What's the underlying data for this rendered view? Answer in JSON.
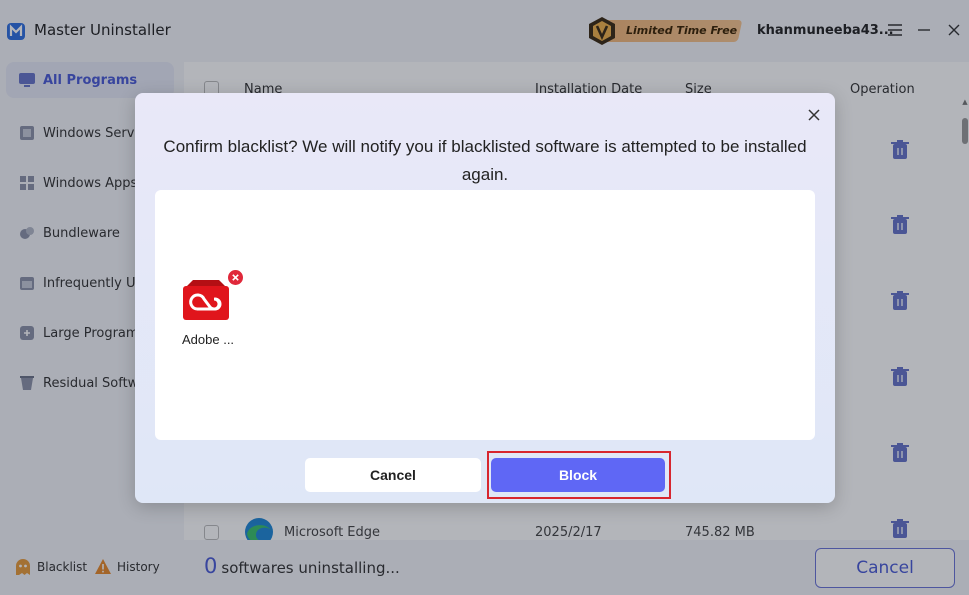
{
  "app": {
    "title": "Master Uninstaller"
  },
  "header": {
    "promo_text": "Limited Time Free",
    "username": "khanmuneeba43..."
  },
  "sidebar": {
    "items": [
      {
        "label": "All Programs",
        "icon": "monitor-icon",
        "active": true
      },
      {
        "label": "Windows Servi",
        "icon": "windows-service-icon"
      },
      {
        "label": "Windows Apps",
        "icon": "windows-apps-icon"
      },
      {
        "label": "Bundleware",
        "icon": "bundle-icon"
      },
      {
        "label": "Infrequently Us",
        "icon": "calendar-icon"
      },
      {
        "label": "Large Program",
        "icon": "large-program-icon"
      },
      {
        "label": "Residual Softw",
        "icon": "residual-icon"
      }
    ]
  },
  "table": {
    "headers": {
      "name": "Name",
      "install_date": "Installation Date",
      "size": "Size",
      "operation": "Operation"
    },
    "visible_row": {
      "name": "Microsoft Edge",
      "install_date": "2025/2/17",
      "size": "745.82 MB"
    }
  },
  "footer": {
    "blacklist_label": "Blacklist",
    "history_label": "History",
    "uninstalling_count": "0",
    "uninstalling_text": "softwares uninstalling...",
    "cancel_label": "Cancel"
  },
  "dialog": {
    "title": "Confirm blacklist? We will notify you if blacklisted software is attempted to be installed again.",
    "apps": [
      {
        "name": "Adobe ...",
        "icon": "adobe-creative-cloud-icon"
      }
    ],
    "cancel_label": "Cancel",
    "block_label": "Block"
  },
  "colors": {
    "accent": "#5f67f5",
    "highlight_border": "#d7262f",
    "adobe_red": "#e0151c"
  }
}
